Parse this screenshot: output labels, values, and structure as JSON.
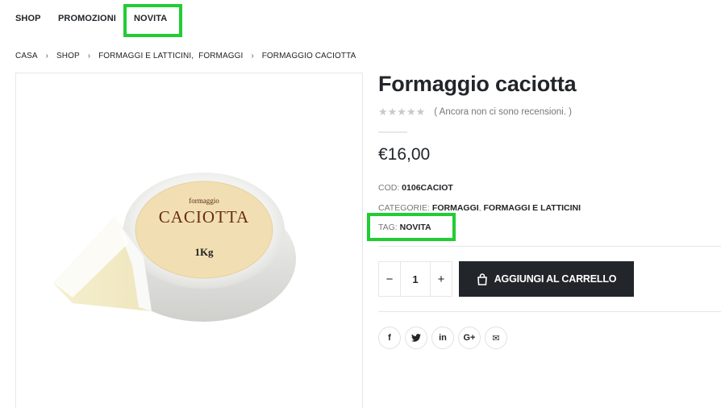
{
  "nav": {
    "items": [
      {
        "label": "SHOP"
      },
      {
        "label": "PROMOZIONI"
      },
      {
        "label": "NOVITA"
      }
    ]
  },
  "breadcrumb": {
    "items": [
      "CASA",
      "SHOP",
      "FORMAGGI E LATTICINI,",
      "FORMAGGI",
      "FORMAGGIO CACIOTTA"
    ]
  },
  "product": {
    "image_label_small": "formaggio",
    "image_label_big": "CACIOTTA",
    "image_label_weight": "1Kg",
    "title": "Formaggio caciotta",
    "rating_stars": "★★★★★",
    "rating_value": 0,
    "reviews_text": "( Ancora non ci sono recensioni. )",
    "price": "€16,00",
    "sku_label": "COD:",
    "sku": "0106CACIOT",
    "categories_label": "CATEGORIE:",
    "categories": [
      "FORMAGGI",
      "FORMAGGI E LATTICINI"
    ],
    "categories_sep": ",",
    "tag_label": "TAG:",
    "tag": "NOVITA",
    "qty_minus": "−",
    "qty_value": "1",
    "qty_plus": "+",
    "add_to_cart": "AGGIUNGI AL CARRELLO"
  },
  "share": {
    "icons": [
      {
        "name": "facebook-icon",
        "glyph": "f"
      },
      {
        "name": "twitter-icon",
        "glyph": "t"
      },
      {
        "name": "linkedin-icon",
        "glyph": "in"
      },
      {
        "name": "googleplus-icon",
        "glyph": "G+"
      },
      {
        "name": "email-icon",
        "glyph": "✉"
      }
    ]
  },
  "colors": {
    "highlight": "#22cc33",
    "primary_dark": "#222529",
    "muted_text": "#777777",
    "border": "#e7e7e7"
  }
}
